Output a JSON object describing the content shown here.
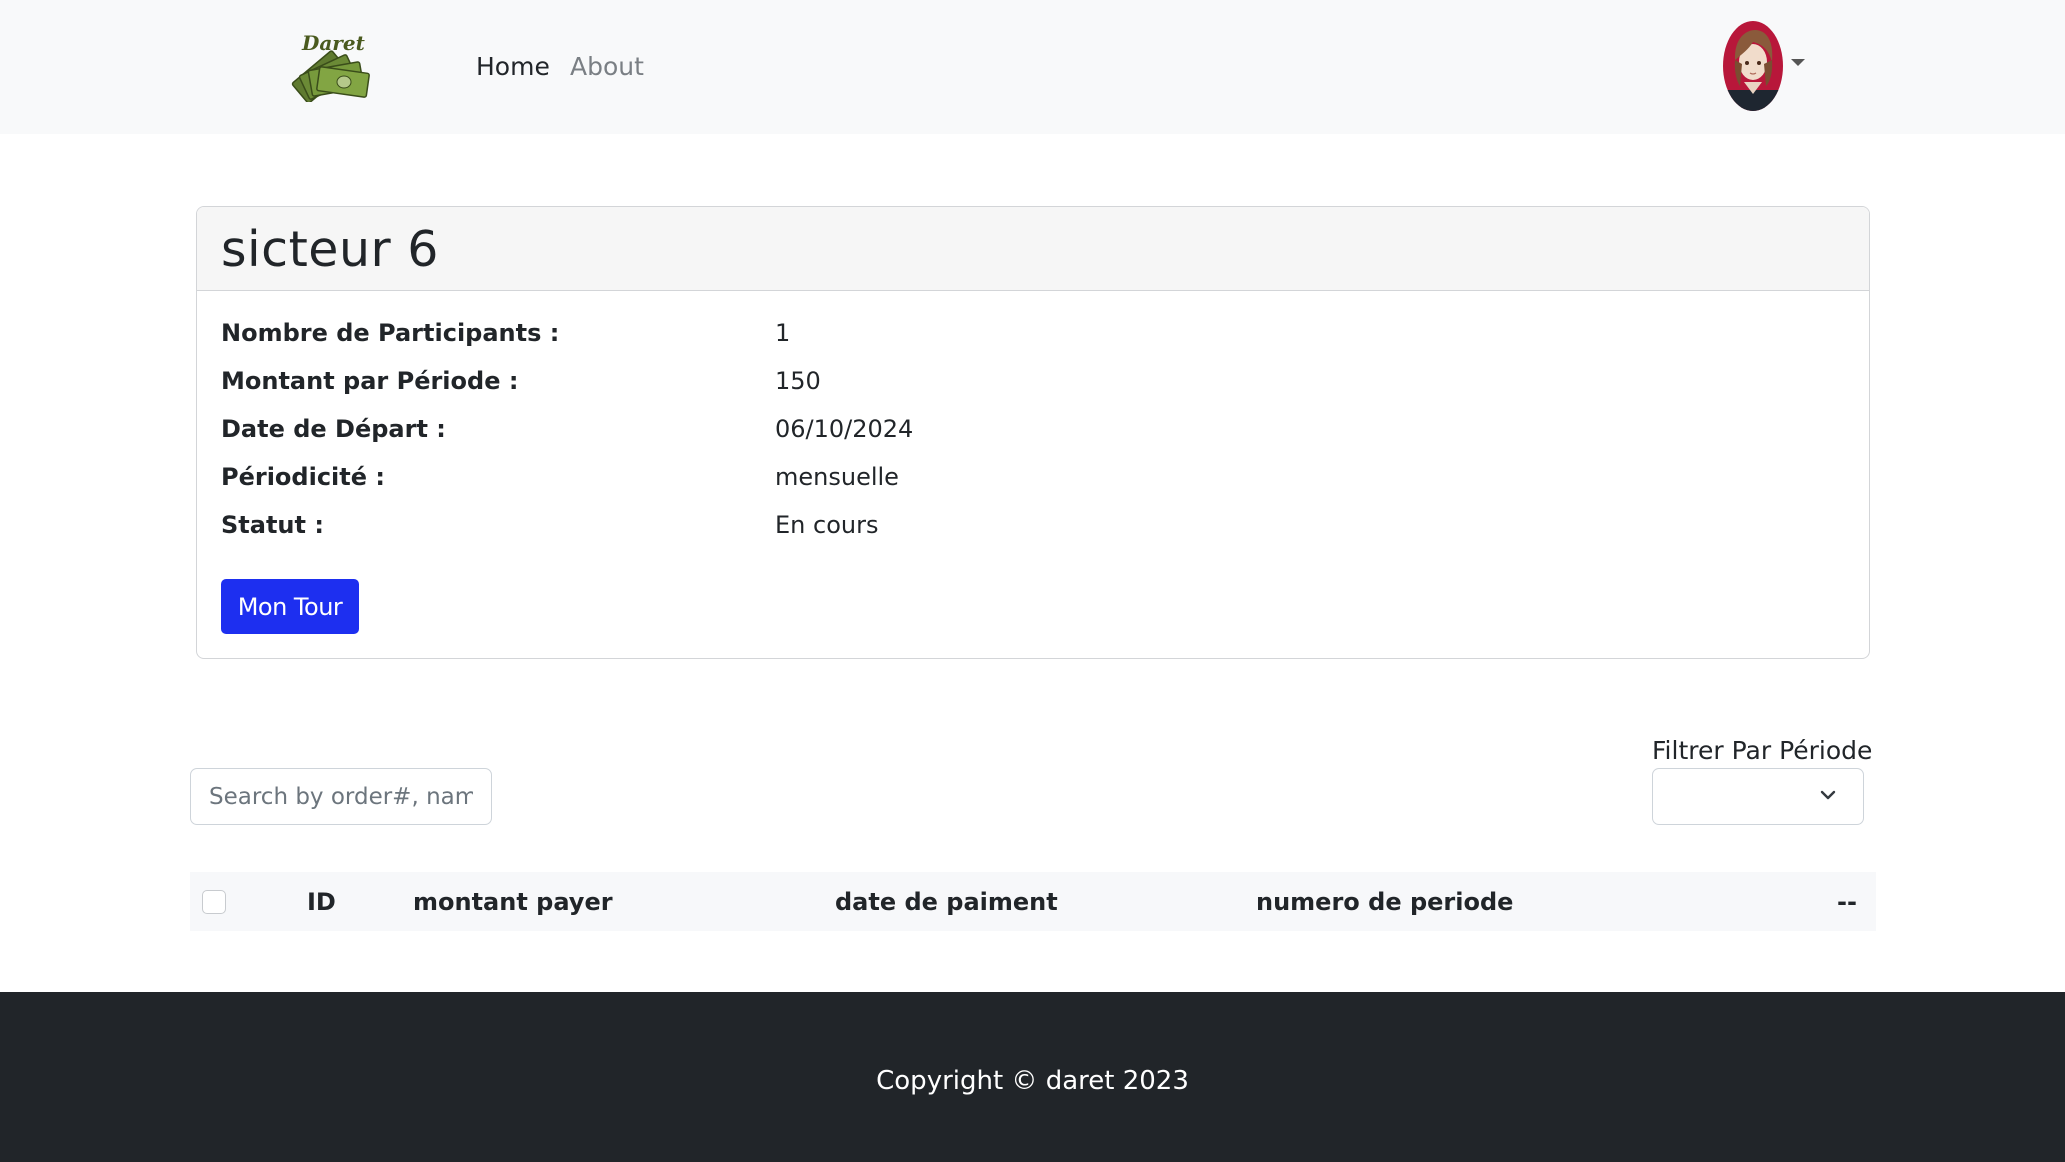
{
  "navbar": {
    "brand_text": "Daret",
    "links": [
      {
        "label": "Home"
      },
      {
        "label": "About"
      }
    ]
  },
  "card": {
    "title": "sicteur 6",
    "rows": [
      {
        "label": "Nombre de Participants :",
        "value": "1"
      },
      {
        "label": "Montant par Période :",
        "value": "150"
      },
      {
        "label": "Date de Départ :",
        "value": "06/10/2024"
      },
      {
        "label": "Périodicité :",
        "value": "mensuelle"
      },
      {
        "label": "Statut :",
        "value": "En cours"
      }
    ],
    "button_label": "Mon Tour"
  },
  "filters": {
    "search_placeholder": "Search by order#, name...",
    "period_label": "Filtrer Par Période",
    "period_value": ""
  },
  "table": {
    "columns": [
      "ID",
      "montant payer",
      "date de paiment",
      "numero de periode",
      "--"
    ]
  },
  "footer": {
    "copyright": "Copyright © daret 2023"
  },
  "colors": {
    "primary_button": "#1d2ff0",
    "navbar_bg": "#f8f9fa",
    "footer_bg": "#212529"
  }
}
